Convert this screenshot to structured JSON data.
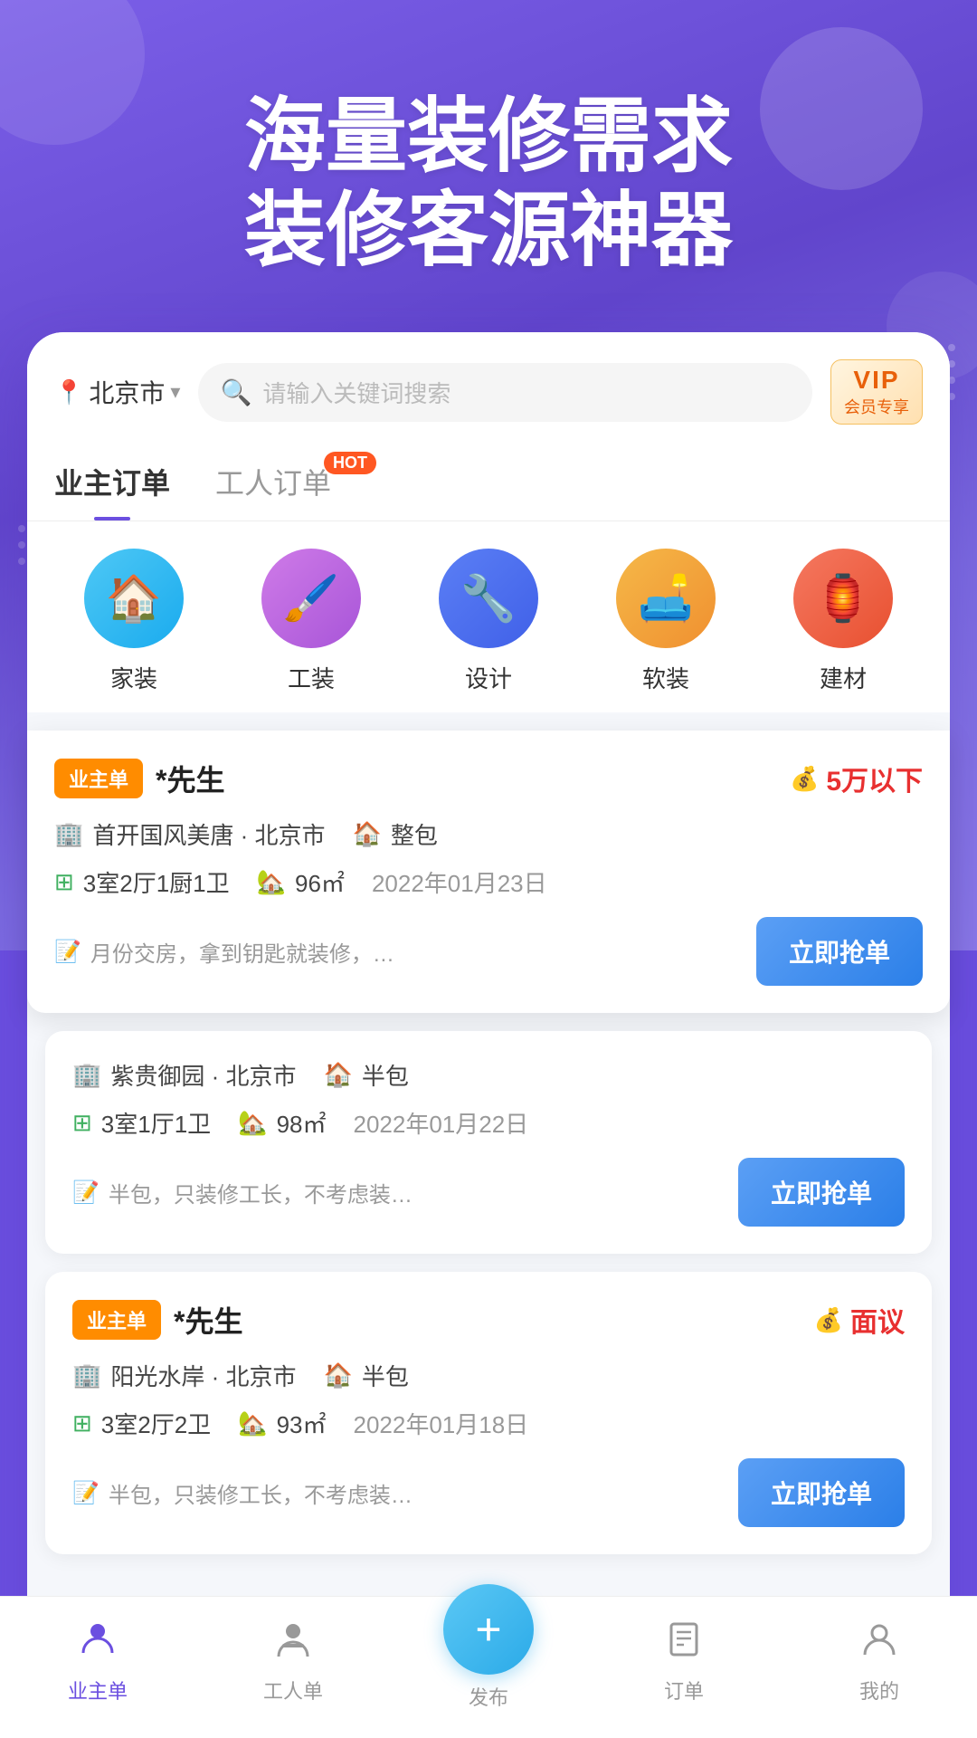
{
  "app": {
    "title": "装修客源神器"
  },
  "hero": {
    "line1": "海量装修需求",
    "line2": "装修客源神器"
  },
  "search": {
    "location": "北京市",
    "placeholder": "请输入关键词搜索",
    "vip_label": "VIP",
    "vip_sub": "会员专享"
  },
  "tabs": [
    {
      "id": "owner",
      "label": "业主订单",
      "active": true,
      "hot": false
    },
    {
      "id": "worker",
      "label": "工人订单",
      "active": false,
      "hot": true
    }
  ],
  "categories": [
    {
      "id": "home",
      "label": "家装",
      "icon": "🏠",
      "color": "cat-blue"
    },
    {
      "id": "commercial",
      "label": "工装",
      "icon": "🖌️",
      "color": "cat-purple"
    },
    {
      "id": "design",
      "label": "设计",
      "icon": "✏️",
      "color": "cat-indigo"
    },
    {
      "id": "soft",
      "label": "软装",
      "icon": "🛋️",
      "color": "cat-orange"
    },
    {
      "id": "material",
      "label": "建材",
      "icon": "🏮",
      "color": "cat-red"
    }
  ],
  "orders": [
    {
      "id": 1,
      "featured": true,
      "type_badge": "业主单",
      "client_name": "*先生",
      "budget": "5万以下",
      "location": "首开国风美唐 · 北京市",
      "package_type": "整包",
      "room_info": "3室2厅1厨1卫",
      "area": "96㎡",
      "date": "2022年01月23日",
      "note": "月份交房，拿到钥匙就装修，…",
      "btn_label": "立即抢单"
    },
    {
      "id": 2,
      "featured": false,
      "type_badge": "",
      "client_name": "",
      "budget": "",
      "location": "紫贵御园 · 北京市",
      "package_type": "半包",
      "room_info": "3室1厅1卫",
      "area": "98㎡",
      "date": "2022年01月22日",
      "note": "半包，只装修工长，不考虑装…",
      "btn_label": "立即抢单"
    },
    {
      "id": 3,
      "featured": false,
      "type_badge": "业主单",
      "client_name": "*先生",
      "budget": "面议",
      "location": "阳光水岸 · 北京市",
      "package_type": "半包",
      "room_info": "3室2厅2卫",
      "area": "93㎡",
      "date": "2022年01月18日",
      "note": "半包，只装修工长，不考虑装…",
      "btn_label": "立即抢单"
    }
  ],
  "nav": {
    "items": [
      {
        "id": "owner-tab",
        "icon": "👤",
        "label": "业主单",
        "active": true
      },
      {
        "id": "worker-tab",
        "icon": "👷",
        "label": "工人单",
        "active": false
      },
      {
        "id": "publish-tab",
        "icon": "+",
        "label": "发布",
        "active": false,
        "is_add": true
      },
      {
        "id": "order-tab",
        "icon": "📋",
        "label": "订单",
        "active": false
      },
      {
        "id": "me-tab",
        "icon": "😊",
        "label": "我的",
        "active": false
      }
    ]
  }
}
